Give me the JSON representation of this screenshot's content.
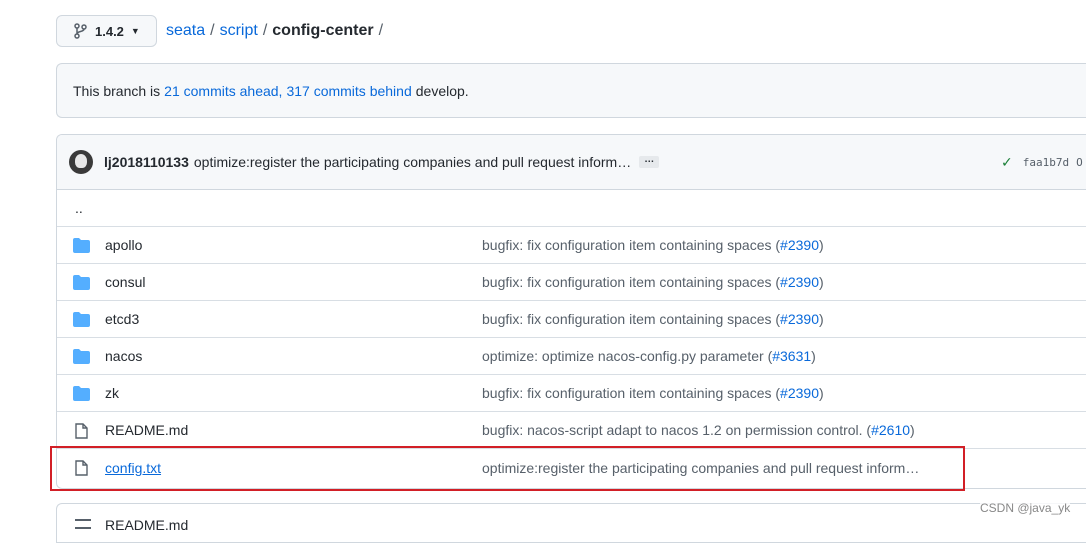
{
  "branch": {
    "name": "1.4.2"
  },
  "breadcrumb": {
    "repo": "seata",
    "folder": "script",
    "current": "config-center",
    "separator": "/"
  },
  "notice": {
    "prefix": "This branch is ",
    "ahead": "21 commits ahead,",
    "behind": "317 commits behind",
    "suffix": "develop."
  },
  "commit": {
    "author": "lj2018110133",
    "message": "optimize:register the participating companies and pull request inform…",
    "ellipsis": "…",
    "sha": "faa1b7d",
    "sha_tail": "O"
  },
  "parent_dir": "..",
  "files": [
    {
      "type": "folder",
      "name": "apollo",
      "msg": "bugfix: fix configuration item containing spaces (",
      "pr": "#2390",
      "close": ")"
    },
    {
      "type": "folder",
      "name": "consul",
      "msg": "bugfix: fix configuration item containing spaces (",
      "pr": "#2390",
      "close": ")"
    },
    {
      "type": "folder",
      "name": "etcd3",
      "msg": "bugfix: fix configuration item containing spaces (",
      "pr": "#2390",
      "close": ")"
    },
    {
      "type": "folder",
      "name": "nacos",
      "msg": "optimize: optimize nacos-config.py parameter (",
      "pr": "#3631",
      "close": ")"
    },
    {
      "type": "folder",
      "name": "zk",
      "msg": "bugfix: fix configuration item containing spaces (",
      "pr": "#2390",
      "close": ")"
    },
    {
      "type": "file",
      "name": "README.md",
      "msg": "bugfix: nacos-script adapt to nacos 1.2 on permission control. (",
      "pr": "#2610",
      "close": ")"
    },
    {
      "type": "file",
      "name": "config.txt",
      "msg": "optimize:register the participating companies and pull request inform…",
      "pr": "",
      "close": ""
    }
  ],
  "readme": {
    "title": "README.md"
  },
  "watermark": "CSDN @java_yk",
  "colors": {
    "link": "#0969da",
    "folder": "#54aeff",
    "highlight": "#d21f26",
    "check": "#1a7f37"
  }
}
